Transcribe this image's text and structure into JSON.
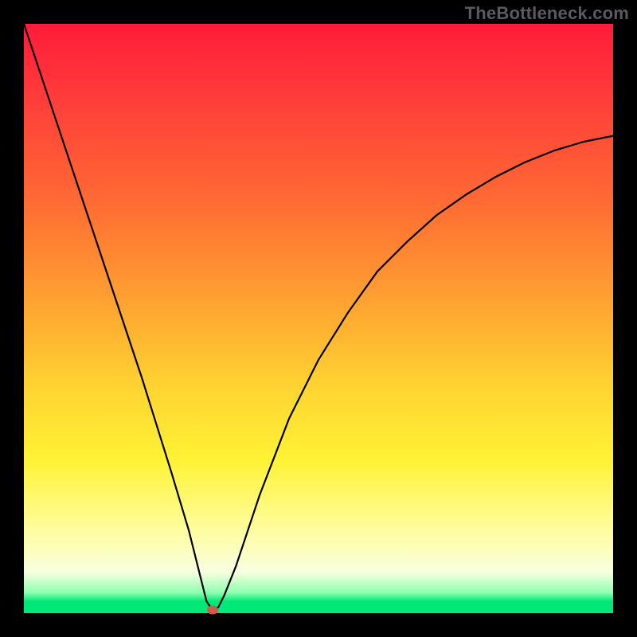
{
  "watermark": "TheBottleneck.com",
  "chart_data": {
    "type": "line",
    "title": "",
    "xlabel": "",
    "ylabel": "",
    "xlim": [
      0,
      100
    ],
    "ylim": [
      0,
      100
    ],
    "grid": false,
    "legend": null,
    "notes": "Vertical axis represents bottleneck percentage (0 at bottom/green, ~100 at top/red). Horizontal axis is an unlabeled parameter. Minimum (≈0) occurs near x≈32.",
    "series": [
      {
        "name": "bottleneck-curve",
        "x": [
          0,
          5,
          10,
          15,
          20,
          25,
          28,
          30,
          31,
          32,
          33,
          34,
          36,
          40,
          45,
          50,
          55,
          60,
          65,
          70,
          75,
          80,
          85,
          90,
          95,
          100
        ],
        "values": [
          100,
          85,
          70,
          55,
          40,
          24,
          14,
          6,
          2,
          0.5,
          1,
          3,
          8,
          20,
          33,
          43,
          51,
          58,
          63,
          67.5,
          71,
          74,
          76.5,
          78.5,
          80,
          81
        ]
      }
    ],
    "marker": {
      "x": 32,
      "y": 0.5,
      "color": "#cf5a4a"
    },
    "background_gradient": {
      "top_color": "#ff1b3a",
      "bottom_color": "#00e87a",
      "meaning": "red = high bottleneck, green = no bottleneck"
    }
  }
}
